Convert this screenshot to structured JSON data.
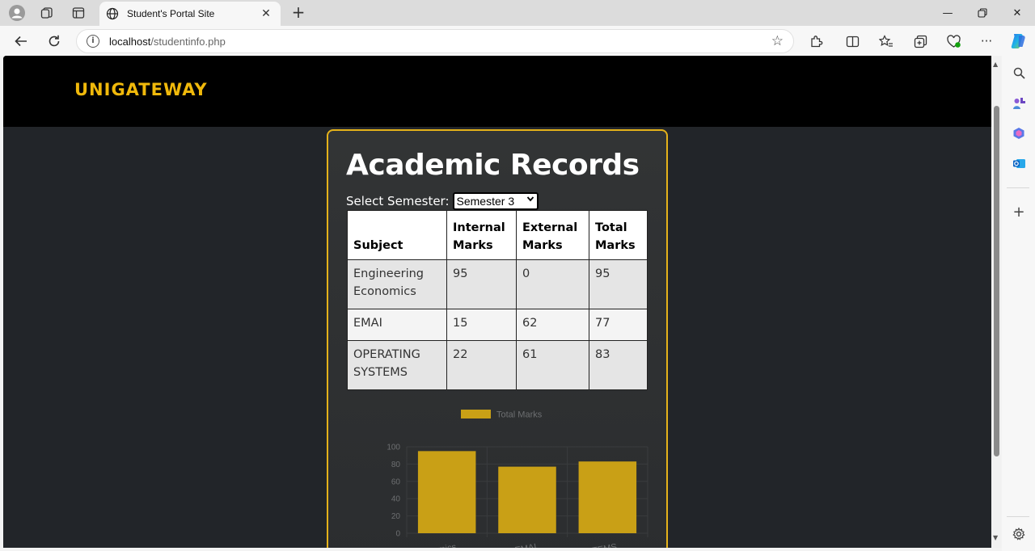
{
  "browser": {
    "tab_title": "Student's Portal Site",
    "url_host": "localhost",
    "url_path": "/studentinfo.php"
  },
  "site": {
    "brand": "UNIGATEWAY",
    "heading": "Academic Records",
    "semester_label": "Select Semester:",
    "semester_selected": "Semester 3"
  },
  "table": {
    "headers": [
      "Subject",
      "Internal Marks",
      "External Marks",
      "Total Marks"
    ],
    "rows": [
      [
        "Engineering Economics",
        "95",
        "0",
        "95"
      ],
      [
        "EMAI",
        "15",
        "62",
        "77"
      ],
      [
        "OPERATING SYSTEMS",
        "22",
        "61",
        "83"
      ]
    ]
  },
  "chart_data": {
    "type": "bar",
    "categories": [
      "Engineering Economics",
      "EMAI",
      "OPERATING SYSTEMS"
    ],
    "series": [
      {
        "name": "Total Marks",
        "values": [
          95,
          77,
          83
        ],
        "color": "#c9a016"
      }
    ],
    "yticks": [
      0,
      20,
      40,
      60,
      80,
      100
    ],
    "ylim": [
      0,
      100
    ],
    "legend": "top",
    "grid": true
  }
}
